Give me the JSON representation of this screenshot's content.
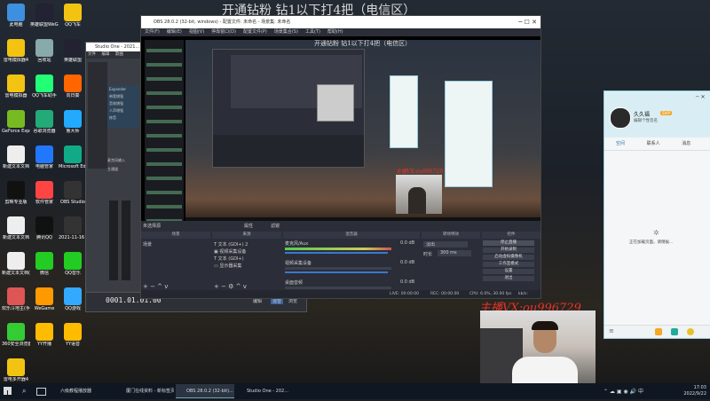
{
  "overlay": {
    "title": "开通钻粉 钻1以下打4把（电信区）",
    "inner_title": "开通钻粉 钻1以下打4把（电信区）",
    "wechat_contact": "主播VX:ou996729",
    "inner_contact": "主播VX:ou996729"
  },
  "desktop_icons": [
    {
      "label": "此电脑",
      "color": "#3d8fe0"
    },
    {
      "label": "英雄联盟WeGame版",
      "color": "#223"
    },
    {
      "label": "QQ飞车",
      "color": "#f3c312"
    },
    {
      "label": "雷电模拟器4",
      "color": "#f3c312"
    },
    {
      "label": "回收站",
      "color": "#8aa"
    },
    {
      "label": "英雄联盟",
      "color": "#223"
    },
    {
      "label": "雷电模拟器",
      "color": "#f3c312"
    },
    {
      "label": "QQ飞车助手",
      "color": "#2f7"
    },
    {
      "label": "向日葵",
      "color": "#f60"
    },
    {
      "label": "GeForce Experience",
      "color": "#7b2"
    },
    {
      "label": "谷歌浏览器",
      "color": "#2a7"
    },
    {
      "label": "鲁大师",
      "color": "#2af"
    },
    {
      "label": "新建文本文档",
      "color": "#eee"
    },
    {
      "label": "电脑管家",
      "color": "#27f"
    },
    {
      "label": "Microsoft Edge",
      "color": "#1a8"
    },
    {
      "label": "剪映专业版",
      "color": "#111"
    },
    {
      "label": "软件管家",
      "color": "#f44"
    },
    {
      "label": "OBS Studio",
      "color": "#333"
    },
    {
      "label": "新建文本文档",
      "color": "#eee"
    },
    {
      "label": "腾讯QQ",
      "color": "#111"
    },
    {
      "label": "2021-11-16 Team AIR",
      "color": "#333"
    },
    {
      "label": "新建文本文档(4)",
      "color": "#eee"
    },
    {
      "label": "微信",
      "color": "#2c2"
    },
    {
      "label": "QQ音乐",
      "color": "#2c2"
    },
    {
      "label": "欢乐斗地主(手游模拟器)",
      "color": "#d55"
    },
    {
      "label": "WeGame",
      "color": "#f90"
    },
    {
      "label": "QQ游戏",
      "color": "#3af"
    },
    {
      "label": "360安全浏览器",
      "color": "#3c3"
    },
    {
      "label": "YY开播",
      "color": "#fb0"
    },
    {
      "label": "YY语音",
      "color": "#fb0"
    },
    {
      "label": "雷电多开器4",
      "color": "#f3c312"
    }
  ],
  "obs": {
    "window_title": "OBS 28.0.2 (32-bit, windows) - 配置文件: 未命名 - 场景集: 未命名",
    "menu": [
      "文件(F)",
      "编辑(E)",
      "视图(V)",
      "停靠窗口(D)",
      "配置文件(P)",
      "场景集合(S)",
      "工具(T)",
      "帮助(H)"
    ],
    "source_none": "未选择源",
    "props_btn": "属性",
    "filter_btn": "滤镜",
    "docks": {
      "scenes": "场景",
      "sources": "来源",
      "mixer": "混音器",
      "transitions": "转场特效",
      "controls": "控件"
    },
    "scene_item": "场景",
    "sources": [
      "文本 (GDI+) 2",
      "视频采集设备",
      "文本 (GDI+)",
      "显示器采集"
    ],
    "mixer": [
      {
        "name": "麦克风/Aux",
        "db": "0.0 dB"
      },
      {
        "name": "视频采集设备",
        "db": "0.0 dB"
      },
      {
        "name": "桌面音频",
        "db": "0.0 dB"
      }
    ],
    "transition": {
      "type": "淡出",
      "duration_label": "时长",
      "duration": "300 ms"
    },
    "controls": [
      "停止直播",
      "开始录制",
      "启动虚拟摄像机",
      "工作室模式",
      "设置",
      "退出"
    ],
    "status": {
      "live_label": "LIVE:",
      "live_time": "00:00:00",
      "rec_label": "REC:",
      "rec_time": "00:00:00",
      "cpu": "CPU: 6.0%, 30.00 fps",
      "kbps": "kb/s:"
    }
  },
  "studio": {
    "title": "Studio One - 2021...",
    "menu": [
      "文件",
      "编辑",
      "歌曲"
    ],
    "tree": [
      "Expander",
      "带宽增强",
      "音效增强",
      "人声增强",
      "修音"
    ],
    "labels": [
      "麦克风输入",
      "主通道"
    ],
    "time": "0001.01.01.00",
    "tabs": [
      "编辑",
      "混音",
      "浏览"
    ]
  },
  "qq": {
    "name": "久久福",
    "badge": "SVIP",
    "signature": "编辑个性签名",
    "tabs": [
      "空间",
      "联系人",
      "消息"
    ],
    "loading": "正在加载页面，请稍候..."
  },
  "taskbar": {
    "items": [
      {
        "label": "六级教程播放器",
        "active": false
      },
      {
        "label": "",
        "active": false
      },
      {
        "label": "厦门在线资料 - 新标签页...",
        "active": false
      },
      {
        "label": "OBS 28.0.2 (32-bit)...",
        "active": true
      },
      {
        "label": "Studio One - 202...",
        "active": false
      }
    ],
    "time": "17:03",
    "date": "2022/9/22"
  }
}
